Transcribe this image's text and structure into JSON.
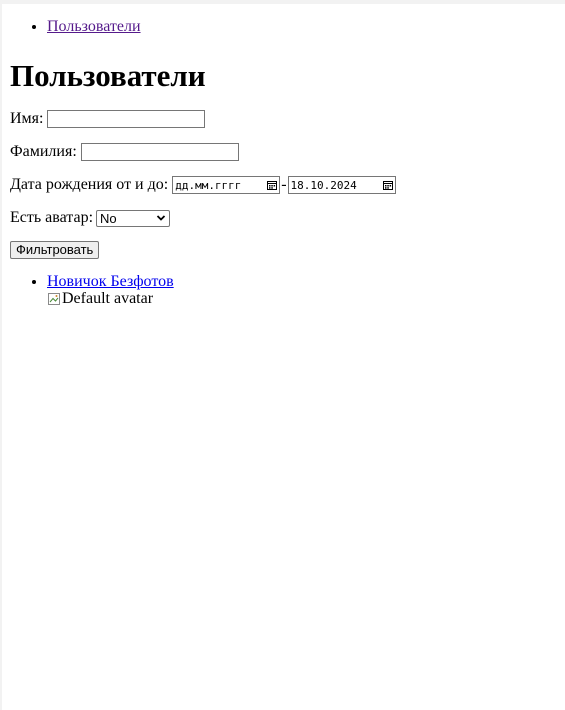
{
  "nav": {
    "users_link": "Пользователи"
  },
  "page": {
    "title": "Пользователи"
  },
  "filters": {
    "first_name_label": "Имя:",
    "first_name_value": "",
    "last_name_label": "Фамилия:",
    "last_name_value": "",
    "birth_label": "Дата рождения от и до:",
    "birth_from_value": "дд.мм.гггг",
    "birth_separator": "-",
    "birth_to_value": "18.10.2024",
    "avatar_label": "Есть аватар:",
    "avatar_selected": "No",
    "submit_label": "Фильтровать"
  },
  "results": [
    {
      "name": "Новичок Безфотов",
      "avatar_alt": "Default avatar"
    }
  ],
  "icons": {
    "calendar": "calendar-icon",
    "dropdown": "chevron-down-icon",
    "broken_image": "broken-image-icon"
  }
}
